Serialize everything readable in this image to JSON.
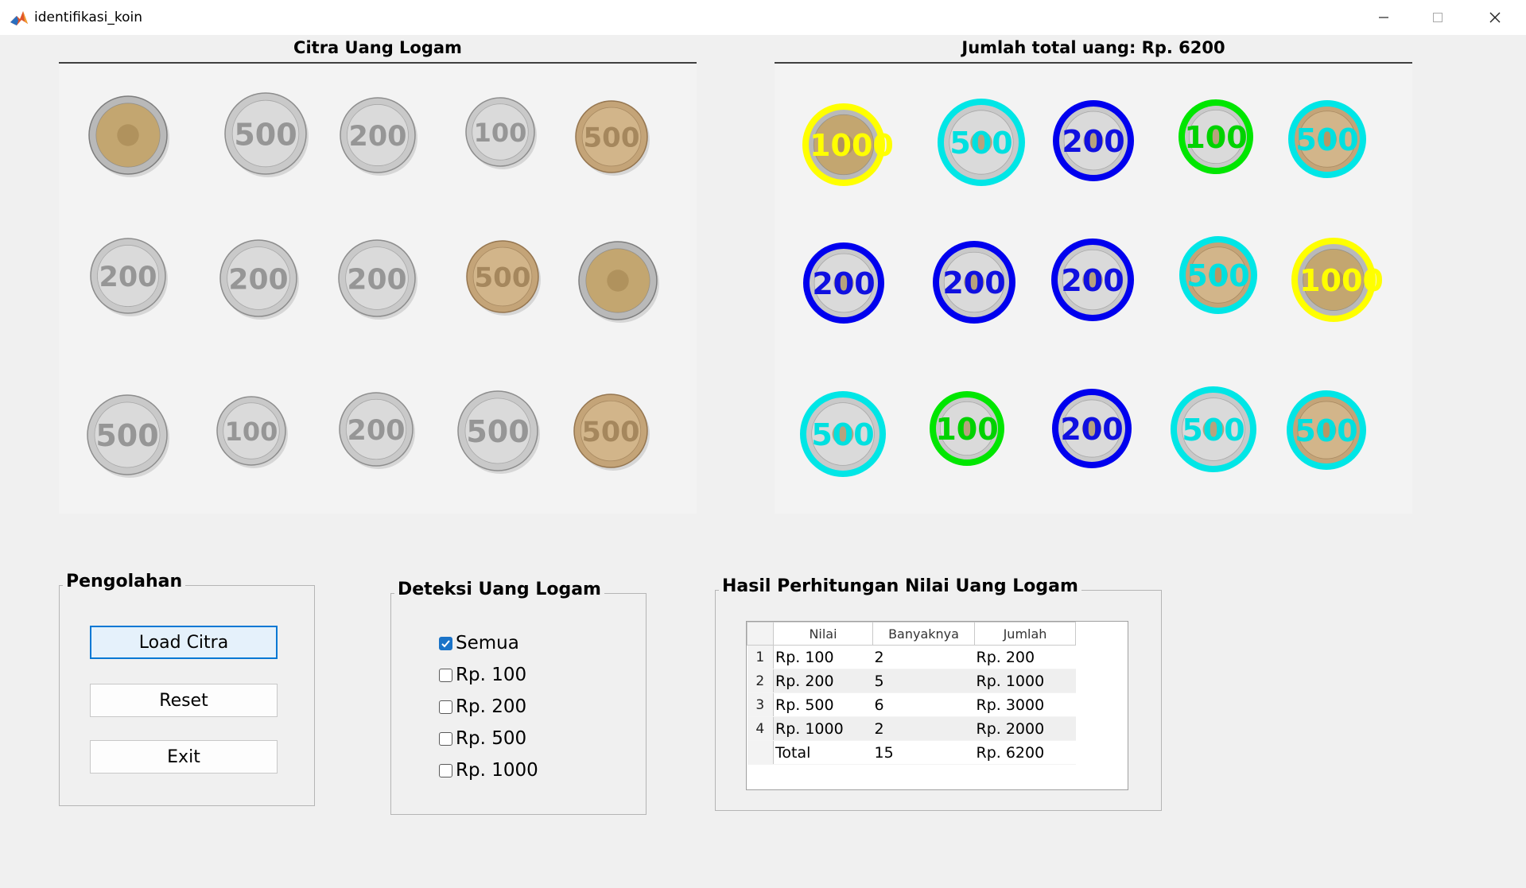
{
  "window": {
    "title": "identifikasi_koin",
    "controls": [
      "minimize",
      "maximize",
      "close"
    ]
  },
  "left_axes": {
    "title": "Citra Uang Logam",
    "coins": [
      {
        "type": "bimetal",
        "label": ""
      },
      {
        "type": "silver",
        "label": "500"
      },
      {
        "type": "silver",
        "label": "200"
      },
      {
        "type": "silver",
        "label": "100"
      },
      {
        "type": "gold",
        "label": "500"
      },
      {
        "type": "silver",
        "label": "200"
      },
      {
        "type": "silver",
        "label": "200"
      },
      {
        "type": "silver",
        "label": "200"
      },
      {
        "type": "gold",
        "label": "500"
      },
      {
        "type": "bimetal",
        "label": ""
      },
      {
        "type": "silver",
        "label": "500"
      },
      {
        "type": "silver",
        "label": "100"
      },
      {
        "type": "silver",
        "label": "200"
      },
      {
        "type": "silver",
        "label": "500"
      },
      {
        "type": "gold",
        "label": "500"
      }
    ]
  },
  "right_axes": {
    "title": "Jumlah total uang: Rp. 6200",
    "ring_colors": {
      "100": "#00e600",
      "200": "#0000ee",
      "500": "#00e6e6",
      "1000": "#ffff00"
    },
    "text_colors": {
      "100": "#00d200",
      "200": "#1010e0",
      "500": "#00e0e0",
      "1000": "#ffff00"
    },
    "detections": [
      {
        "value": "1000",
        "coin": "bimetal"
      },
      {
        "value": "500",
        "coin": "silver"
      },
      {
        "value": "200",
        "coin": "silver"
      },
      {
        "value": "100",
        "coin": "silver"
      },
      {
        "value": "500",
        "coin": "gold"
      },
      {
        "value": "200",
        "coin": "silver"
      },
      {
        "value": "200",
        "coin": "silver"
      },
      {
        "value": "200",
        "coin": "silver"
      },
      {
        "value": "500",
        "coin": "gold"
      },
      {
        "value": "1000",
        "coin": "bimetal"
      },
      {
        "value": "500",
        "coin": "silver"
      },
      {
        "value": "100",
        "coin": "silver"
      },
      {
        "value": "200",
        "coin": "silver"
      },
      {
        "value": "500",
        "coin": "silver"
      },
      {
        "value": "500",
        "coin": "gold"
      }
    ]
  },
  "pengolahan": {
    "title": "Pengolahan",
    "load_label": "Load Citra",
    "reset_label": "Reset",
    "exit_label": "Exit"
  },
  "deteksi": {
    "title": "Deteksi Uang Logam",
    "options": [
      {
        "label": "Semua",
        "checked": true
      },
      {
        "label": "Rp. 100",
        "checked": false
      },
      {
        "label": "Rp. 200",
        "checked": false
      },
      {
        "label": "Rp. 500",
        "checked": false
      },
      {
        "label": "Rp. 1000",
        "checked": false
      }
    ]
  },
  "hasil": {
    "title": "Hasil Perhitungan Nilai Uang Logam",
    "columns": [
      "Nilai",
      "Banyaknya",
      "Jumlah"
    ],
    "rows": [
      {
        "header": "1",
        "cells": [
          "Rp. 100",
          "2",
          "Rp. 200"
        ]
      },
      {
        "header": "2",
        "cells": [
          "Rp. 200",
          "5",
          "Rp. 1000"
        ]
      },
      {
        "header": "3",
        "cells": [
          "Rp. 500",
          "6",
          "Rp. 3000"
        ]
      },
      {
        "header": "4",
        "cells": [
          "Rp. 1000",
          "2",
          "Rp. 2000"
        ]
      },
      {
        "header": "",
        "cells": [
          "Total",
          "15",
          "Rp. 6200"
        ]
      }
    ]
  }
}
